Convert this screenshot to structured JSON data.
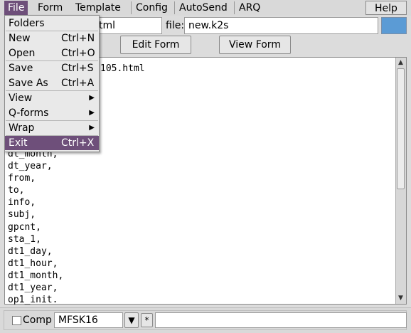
{
  "menubar": {
    "items": [
      "File",
      "Form",
      "Template",
      "Config",
      "AutoSend",
      "ARQ"
    ],
    "help": "Help"
  },
  "inputs": {
    "form_value": "tml",
    "file_label": "file:",
    "file_value": "new.k2s",
    "swatch_color": "#5b9bd5"
  },
  "buttons": {
    "edit_form": "Edit Form",
    "view_form": "View Form"
  },
  "editor": {
    "first_line_partial": "105.html",
    "lines": [
      "dt_month,",
      "dt_year,",
      "from,",
      "to,",
      "info,",
      "subj,",
      "gpcnt,",
      "sta_1,",
      "dt1_day,",
      "dt1_hour,",
      "dt1_month,",
      "dt1_year,",
      "op1_init."
    ]
  },
  "file_menu": {
    "folders": "Folders",
    "new": "New",
    "new_shortcut": "Ctrl+N",
    "open": "Open",
    "open_shortcut": "Ctrl+O",
    "save": "Save",
    "save_shortcut": "Ctrl+S",
    "save_as": "Save As",
    "save_as_shortcut": "Ctrl+A",
    "view": "View",
    "qforms": "Q-forms",
    "wrap": "Wrap",
    "exit": "Exit",
    "exit_shortcut": "Ctrl+X",
    "highlight_color": "#6e4f7a"
  },
  "statusbar": {
    "comp_label": "Comp",
    "mode": "MFSK16",
    "star": "*",
    "message": ""
  }
}
